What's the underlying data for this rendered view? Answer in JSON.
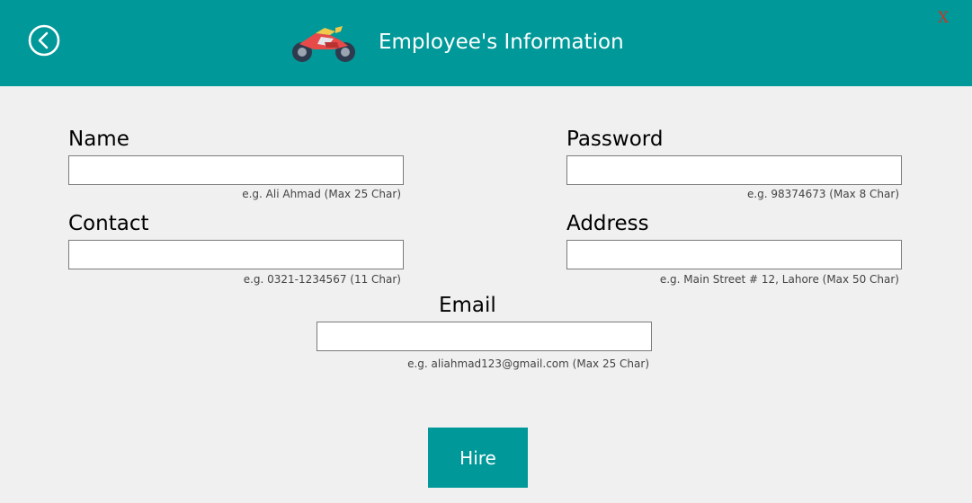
{
  "header": {
    "title": "Employee's Information",
    "close_label": "X",
    "accent_color": "#009898",
    "back_icon": "circle-chevron-left-icon",
    "logo_icon": "motorcycle-icon"
  },
  "form": {
    "name": {
      "label": "Name",
      "value": "",
      "hint": "e.g. Ali Ahmad (Max 25 Char)"
    },
    "password": {
      "label": "Password",
      "value": "",
      "hint": "e.g. 98374673 (Max 8 Char)"
    },
    "contact": {
      "label": "Contact",
      "value": "",
      "hint": "e.g. 0321-1234567 (11 Char)"
    },
    "address": {
      "label": "Address",
      "value": "",
      "hint": "e.g. Main Street # 12, Lahore (Max 50 Char)"
    },
    "email": {
      "label": "Email",
      "value": "",
      "hint": "e.g. aliahmad123@gmail.com (Max 25 Char)"
    }
  },
  "hire_label": "Hire"
}
